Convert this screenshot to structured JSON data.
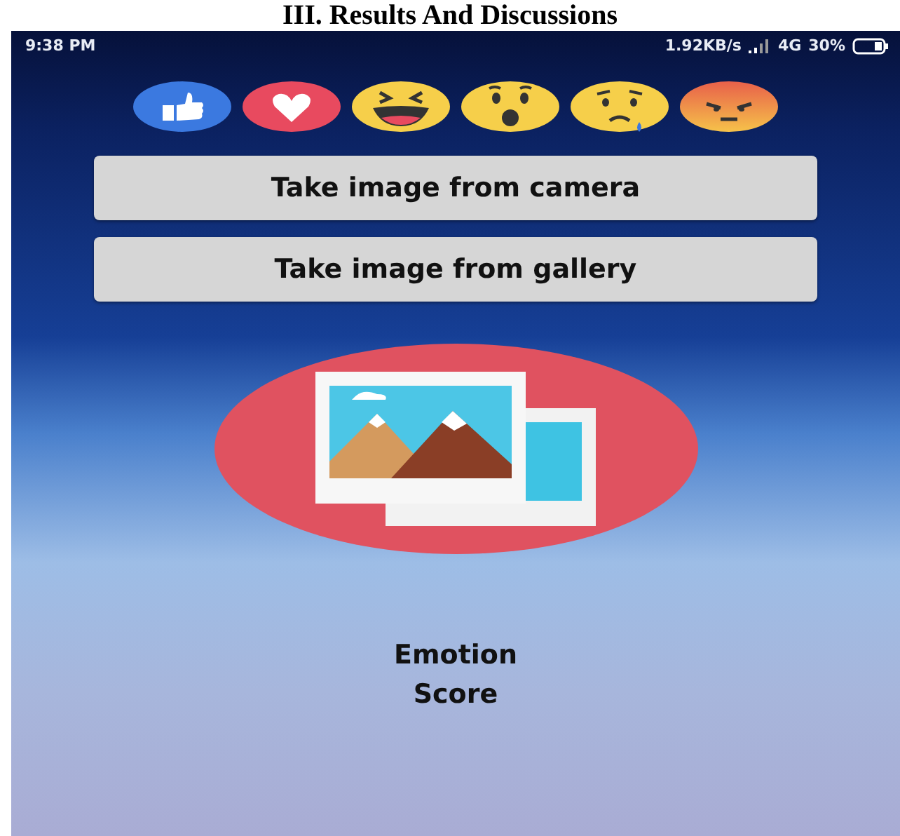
{
  "heading": "III. Results And Discussions",
  "status_bar": {
    "time": "9:38 PM",
    "speed": "1.92KB/s",
    "network": "4G",
    "battery": "30%"
  },
  "reactions": [
    {
      "kind": "like"
    },
    {
      "kind": "love"
    },
    {
      "kind": "haha"
    },
    {
      "kind": "wow"
    },
    {
      "kind": "sad"
    },
    {
      "kind": "angry"
    }
  ],
  "buttons": [
    "Take image from camera",
    "Take image from gallery"
  ],
  "image_picker": {
    "kind": "gallery"
  },
  "result_label": [
    "Emotion",
    "Score"
  ]
}
